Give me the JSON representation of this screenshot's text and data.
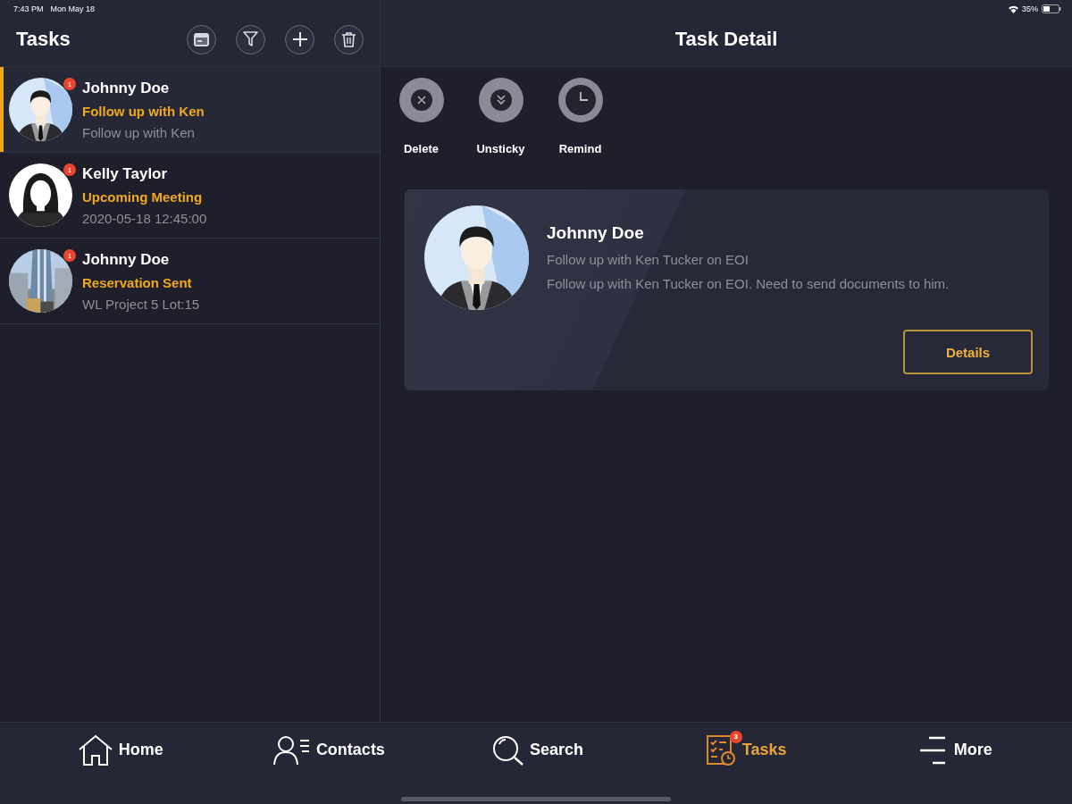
{
  "status_bar": {
    "time": "7:43 PM",
    "date": "Mon May 18",
    "battery": "35%"
  },
  "task_list": {
    "title": "Tasks",
    "items": [
      {
        "avatar": {
          "kind": "male"
        },
        "badge": "1",
        "name": "Johnny Doe",
        "subject": "Follow up with Ken",
        "note": "Follow up with Ken",
        "selected": true
      },
      {
        "avatar": {
          "kind": "female"
        },
        "badge": "1",
        "name": "Kelly Taylor",
        "subject": "Upcoming Meeting",
        "note": "2020-05-18 12:45:00",
        "selected": false
      },
      {
        "badge": "1",
        "name": "Johnny Doe",
        "subject": "Reservation Sent",
        "note": "WL Project 5 Lot:15",
        "selected": false
      }
    ]
  },
  "task_detail": {
    "title": "Task Detail",
    "actions": [
      {
        "label": "Delete"
      },
      {
        "label": "Unsticky"
      },
      {
        "label": "Remind"
      }
    ],
    "card": {
      "avatar": {
        "kind": "male"
      },
      "name": "Johnny Doe",
      "subject": "Follow up with Ken Tucker on EOI",
      "description": "Follow up with Ken Tucker on EOI. Need to send documents to him.",
      "button": "Details"
    }
  },
  "tab_bar": [
    {
      "label": "Home",
      "selected": false
    },
    {
      "label": "Contacts",
      "selected": false
    },
    {
      "label": "Search",
      "selected": false
    },
    {
      "label": "Tasks",
      "selected": true,
      "badge": "3"
    },
    {
      "label": "More",
      "selected": false
    }
  ]
}
